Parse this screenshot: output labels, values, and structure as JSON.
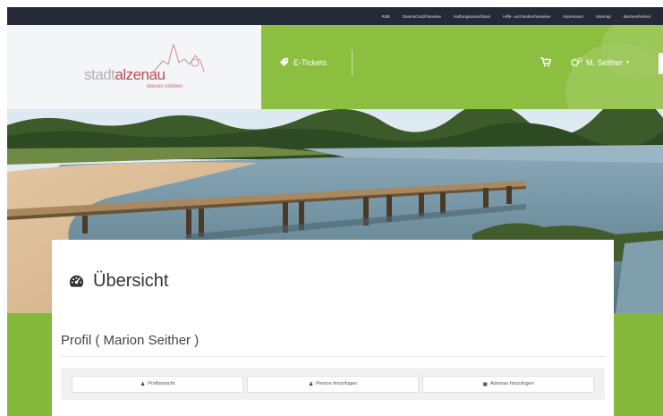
{
  "topnav": {
    "items": [
      "RdB",
      "Datenschutzhinweise",
      "Haftungsausschluss",
      "Hilfe- und Bedienhinweise",
      "Impressum",
      "Sitemap",
      "Barrierefreiheit"
    ]
  },
  "logo": {
    "word_a": "stadt",
    "word_b": "alzenau",
    "tagline": "wiesen erleben"
  },
  "header": {
    "tickets_label": "E-Tickets",
    "user_label": "M. Seither",
    "user_caret": "▾"
  },
  "main": {
    "page_title": "Übersicht",
    "profile_heading": "Profil ( Marion Seither )",
    "buttons": [
      {
        "label": "Profilansicht",
        "icon": "user-icon"
      },
      {
        "label": "Person hinzufügen",
        "icon": "person-add-icon"
      },
      {
        "label": "Adresse hinzufügen",
        "icon": "address-card-icon"
      }
    ]
  },
  "colors": {
    "topnav": "#242b36",
    "accent_green": "#8cbf3f",
    "brand_red": "#b84a5a"
  }
}
